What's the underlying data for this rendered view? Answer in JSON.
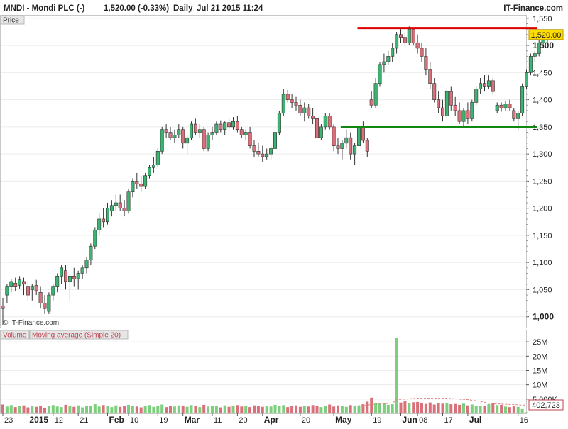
{
  "header": {
    "title": "MNDI - Mondi PLC (-)",
    "quote": "1,520.00 (-0.33%)",
    "period": "Daily",
    "datetime": "Jul 21 2015 11:24",
    "brand": "IT-Finance.com"
  },
  "price_panel": {
    "tab_label": "Price",
    "copyright": "© IT-Finance.com"
  },
  "volume_panel": {
    "tab_volume": "Volume",
    "tab_ma": "Moving average (Simple 20)"
  },
  "colors": {
    "up": "#3cb371",
    "down": "#d9707a",
    "resistance": "#dd0000",
    "support": "#118811",
    "last_price_bg": "#ffdd00",
    "volume_up": "#7ccf7c",
    "volume_down": "#d9707a",
    "ma_line": "#e08080"
  },
  "chart_data": [
    {
      "type": "candlestick",
      "title": "MNDI - Mondi PLC (-)",
      "ylim": [
        980,
        1555
      ],
      "y_ticks": [
        1000,
        1050,
        1100,
        1150,
        1200,
        1250,
        1300,
        1350,
        1400,
        1450,
        1500,
        1550
      ],
      "y_tick_labels": [
        "1,000",
        "1,050",
        "1,100",
        "1,150",
        "1,200",
        "1,250",
        "1,300",
        "1,350",
        "1,400",
        "1,450",
        "1,500",
        "1,550"
      ],
      "major_ticks": [
        1000,
        1500
      ],
      "x_labels": [
        {
          "i": 0,
          "text": "23"
        },
        {
          "i": 6,
          "text": "2015",
          "bold": true
        },
        {
          "i": 12,
          "text": "12"
        },
        {
          "i": 18,
          "text": "21"
        },
        {
          "i": 25,
          "text": "Feb",
          "bold": true
        },
        {
          "i": 30,
          "text": "10"
        },
        {
          "i": 37,
          "text": "19"
        },
        {
          "i": 43,
          "text": "Mar",
          "bold": true
        },
        {
          "i": 50,
          "text": "11"
        },
        {
          "i": 56,
          "text": "20"
        },
        {
          "i": 62,
          "text": "Apr",
          "bold": true
        },
        {
          "i": 71,
          "text": "20"
        },
        {
          "i": 79,
          "text": "May",
          "bold": true
        },
        {
          "i": 88,
          "text": "19"
        },
        {
          "i": 95,
          "text": "Jun",
          "bold": true
        },
        {
          "i": 99,
          "text": "08"
        },
        {
          "i": 105,
          "text": "17"
        },
        {
          "i": 111,
          "text": "Jul",
          "bold": true
        },
        {
          "i": 123,
          "text": "16"
        }
      ],
      "last_price": 1520.0,
      "last_price_label": "1,520.00",
      "resistance": {
        "value": 1532,
        "from": 85,
        "to": 127
      },
      "support": {
        "value": 1350,
        "from": 81,
        "to": 127
      },
      "ohlc": [
        [
          1020,
          1035,
          985,
          1015
        ],
        [
          1040,
          1060,
          1025,
          1055
        ],
        [
          1055,
          1070,
          1045,
          1065
        ],
        [
          1062,
          1072,
          1048,
          1055
        ],
        [
          1058,
          1075,
          1052,
          1068
        ],
        [
          1065,
          1072,
          1040,
          1060
        ],
        [
          1055,
          1065,
          1030,
          1040
        ],
        [
          1050,
          1060,
          1030,
          1055
        ],
        [
          1058,
          1068,
          1040,
          1048
        ],
        [
          1045,
          1055,
          1015,
          1025
        ],
        [
          1025,
          1040,
          1005,
          1015
        ],
        [
          1010,
          1045,
          1005,
          1040
        ],
        [
          1040,
          1060,
          1030,
          1055
        ],
        [
          1055,
          1080,
          1045,
          1075
        ],
        [
          1075,
          1095,
          1060,
          1090
        ],
        [
          1085,
          1095,
          1050,
          1065
        ],
        [
          1065,
          1080,
          1030,
          1075
        ],
        [
          1075,
          1090,
          1055,
          1070
        ],
        [
          1070,
          1085,
          1050,
          1080
        ],
        [
          1080,
          1095,
          1070,
          1090
        ],
        [
          1090,
          1110,
          1080,
          1105
        ],
        [
          1105,
          1135,
          1095,
          1130
        ],
        [
          1130,
          1165,
          1125,
          1160
        ],
        [
          1160,
          1190,
          1150,
          1180
        ],
        [
          1180,
          1200,
          1165,
          1175
        ],
        [
          1175,
          1210,
          1170,
          1200
        ],
        [
          1195,
          1215,
          1185,
          1205
        ],
        [
          1205,
          1225,
          1195,
          1210
        ],
        [
          1210,
          1225,
          1195,
          1200
        ],
        [
          1200,
          1215,
          1185,
          1195
        ],
        [
          1195,
          1235,
          1190,
          1230
        ],
        [
          1230,
          1255,
          1220,
          1250
        ],
        [
          1250,
          1265,
          1235,
          1245
        ],
        [
          1245,
          1260,
          1230,
          1240
        ],
        [
          1240,
          1265,
          1235,
          1260
        ],
        [
          1260,
          1280,
          1255,
          1275
        ],
        [
          1275,
          1295,
          1265,
          1280
        ],
        [
          1280,
          1310,
          1275,
          1305
        ],
        [
          1305,
          1350,
          1300,
          1345
        ],
        [
          1345,
          1355,
          1330,
          1340
        ],
        [
          1340,
          1350,
          1325,
          1330
        ],
        [
          1330,
          1345,
          1320,
          1335
        ],
        [
          1335,
          1355,
          1330,
          1345
        ],
        [
          1345,
          1350,
          1310,
          1320
        ],
        [
          1320,
          1335,
          1300,
          1330
        ],
        [
          1330,
          1360,
          1325,
          1355
        ],
        [
          1355,
          1365,
          1335,
          1340
        ],
        [
          1340,
          1355,
          1330,
          1345
        ],
        [
          1345,
          1350,
          1305,
          1310
        ],
        [
          1310,
          1340,
          1305,
          1335
        ],
        [
          1335,
          1350,
          1325,
          1340
        ],
        [
          1340,
          1360,
          1335,
          1355
        ],
        [
          1355,
          1362,
          1340,
          1345
        ],
        [
          1345,
          1360,
          1335,
          1358
        ],
        [
          1358,
          1365,
          1345,
          1350
        ],
        [
          1350,
          1368,
          1345,
          1360
        ],
        [
          1360,
          1370,
          1340,
          1345
        ],
        [
          1345,
          1350,
          1330,
          1335
        ],
        [
          1335,
          1345,
          1325,
          1340
        ],
        [
          1340,
          1350,
          1310,
          1315
        ],
        [
          1315,
          1325,
          1295,
          1305
        ],
        [
          1305,
          1320,
          1295,
          1300
        ],
        [
          1300,
          1315,
          1285,
          1295
        ],
        [
          1295,
          1310,
          1290,
          1300
        ],
        [
          1300,
          1315,
          1290,
          1310
        ],
        [
          1310,
          1345,
          1305,
          1340
        ],
        [
          1340,
          1380,
          1335,
          1375
        ],
        [
          1375,
          1420,
          1370,
          1410
        ],
        [
          1410,
          1418,
          1395,
          1400
        ],
        [
          1400,
          1410,
          1385,
          1395
        ],
        [
          1395,
          1405,
          1380,
          1390
        ],
        [
          1390,
          1400,
          1370,
          1375
        ],
        [
          1375,
          1395,
          1360,
          1385
        ],
        [
          1385,
          1392,
          1365,
          1370
        ],
        [
          1370,
          1385,
          1355,
          1365
        ],
        [
          1365,
          1375,
          1320,
          1330
        ],
        [
          1330,
          1355,
          1325,
          1350
        ],
        [
          1350,
          1375,
          1345,
          1370
        ],
        [
          1370,
          1375,
          1345,
          1350
        ],
        [
          1350,
          1355,
          1305,
          1315
        ],
        [
          1315,
          1330,
          1300,
          1310
        ],
        [
          1310,
          1325,
          1290,
          1320
        ],
        [
          1320,
          1345,
          1310,
          1330
        ],
        [
          1330,
          1340,
          1290,
          1300
        ],
        [
          1300,
          1320,
          1280,
          1315
        ],
        [
          1315,
          1355,
          1310,
          1350
        ],
        [
          1350,
          1360,
          1320,
          1325
        ],
        [
          1325,
          1330,
          1295,
          1305
        ],
        [
          1400,
          1415,
          1385,
          1390
        ],
        [
          1390,
          1440,
          1385,
          1430
        ],
        [
          1430,
          1470,
          1425,
          1465
        ],
        [
          1465,
          1485,
          1450,
          1470
        ],
        [
          1470,
          1490,
          1465,
          1480
        ],
        [
          1480,
          1505,
          1470,
          1495
        ],
        [
          1495,
          1525,
          1485,
          1520
        ],
        [
          1520,
          1530,
          1505,
          1515
        ],
        [
          1515,
          1525,
          1500,
          1505
        ],
        [
          1505,
          1535,
          1500,
          1530
        ],
        [
          1530,
          1532,
          1500,
          1505
        ],
        [
          1505,
          1520,
          1485,
          1495
        ],
        [
          1495,
          1505,
          1470,
          1480
        ],
        [
          1480,
          1495,
          1445,
          1455
        ],
        [
          1455,
          1470,
          1420,
          1430
        ],
        [
          1430,
          1440,
          1395,
          1400
        ],
        [
          1400,
          1415,
          1375,
          1385
        ],
        [
          1385,
          1400,
          1360,
          1370
        ],
        [
          1370,
          1420,
          1365,
          1415
        ],
        [
          1415,
          1425,
          1380,
          1390
        ],
        [
          1390,
          1405,
          1370,
          1380
        ],
        [
          1380,
          1395,
          1355,
          1360
        ],
        [
          1360,
          1385,
          1350,
          1380
        ],
        [
          1380,
          1395,
          1355,
          1365
        ],
        [
          1365,
          1400,
          1360,
          1395
        ],
        [
          1395,
          1425,
          1390,
          1420
        ],
        [
          1420,
          1440,
          1410,
          1430
        ],
        [
          1430,
          1445,
          1415,
          1425
        ],
        [
          1425,
          1445,
          1420,
          1435
        ],
        [
          1435,
          1440,
          1410,
          1415
        ],
        [
          1380,
          1395,
          1375,
          1390
        ],
        [
          1390,
          1395,
          1378,
          1385
        ],
        [
          1385,
          1398,
          1380,
          1392
        ],
        [
          1392,
          1400,
          1380,
          1385
        ],
        [
          1380,
          1385,
          1360,
          1365
        ],
        [
          1365,
          1380,
          1345,
          1375
        ],
        [
          1375,
          1430,
          1370,
          1425
        ],
        [
          1425,
          1455,
          1420,
          1450
        ],
        [
          1450,
          1485,
          1445,
          1480
        ],
        [
          1480,
          1490,
          1470,
          1485
        ],
        [
          1485,
          1512,
          1480,
          1505
        ],
        [
          1505,
          1520,
          1500,
          1515
        ],
        [
          1515,
          1525,
          1505,
          1520
        ]
      ]
    },
    {
      "type": "bar",
      "title": "Volume",
      "ylim": [
        0,
        29000000
      ],
      "y_ticks": [
        5000000,
        10000000,
        15000000,
        20000000,
        25000000
      ],
      "y_tick_labels": [
        "5,000K",
        "10M",
        "15M",
        "20M",
        "25M"
      ],
      "last_value_label": "402,723",
      "values": [
        3.1,
        2.4,
        2.9,
        2.2,
        2.5,
        2.8,
        2.1,
        2.6,
        2.3,
        2.7,
        2.0,
        2.5,
        2.9,
        2.4,
        2.2,
        3.0,
        2.6,
        2.3,
        2.8,
        2.1,
        2.5,
        2.7,
        3.2,
        2.4,
        2.9,
        2.6,
        2.2,
        2.8,
        2.3,
        2.5,
        3.0,
        2.7,
        2.4,
        2.1,
        2.6,
        2.9,
        2.3,
        2.5,
        3.1,
        2.2,
        2.7,
        2.4,
        2.8,
        2.6,
        2.3,
        2.9,
        2.5,
        2.2,
        3.0,
        2.4,
        2.7,
        2.6,
        2.1,
        2.8,
        2.3,
        2.5,
        2.9,
        2.4,
        2.6,
        2.2,
        2.8,
        2.5,
        2.3,
        2.7,
        2.4,
        3.0,
        2.6,
        2.9,
        2.2,
        2.5,
        2.8,
        2.3,
        2.6,
        2.4,
        2.9,
        2.7,
        2.2,
        2.5,
        3.1,
        2.4,
        2.8,
        2.6,
        2.3,
        2.9,
        2.5,
        2.7,
        3.2,
        4.1,
        5.5,
        3.5,
        3.4,
        3.6,
        3.0,
        3.2,
        26.5,
        3.8,
        4.2,
        3.5,
        3.9,
        4.0,
        3.6,
        3.3,
        3.8,
        3.1,
        3.5,
        3.4,
        3.7,
        3.2,
        3.3,
        3.0,
        3.4,
        2.8,
        3.1,
        2.6,
        2.7,
        2.5,
        3.2,
        3.6,
        2.9,
        3.0,
        2.4,
        2.2,
        2.6,
        2.3,
        1.5,
        0.4
      ],
      "moving_average": [
        2.6,
        2.6,
        2.6,
        2.6,
        2.6,
        2.6,
        2.6,
        2.6,
        2.6,
        2.6,
        2.6,
        2.6,
        2.6,
        2.6,
        2.6,
        2.6,
        2.6,
        2.6,
        2.6,
        2.6,
        2.6,
        2.6,
        2.6,
        2.6,
        2.6,
        2.6,
        2.6,
        2.6,
        2.6,
        2.6,
        2.6,
        2.6,
        2.6,
        2.6,
        2.6,
        2.6,
        2.6,
        2.6,
        2.6,
        2.6,
        2.6,
        2.6,
        2.6,
        2.6,
        2.6,
        2.6,
        2.6,
        2.6,
        2.6,
        2.6,
        2.6,
        2.6,
        2.6,
        2.6,
        2.6,
        2.6,
        2.6,
        2.6,
        2.6,
        2.6,
        2.6,
        2.6,
        2.6,
        2.6,
        2.6,
        2.6,
        2.6,
        2.6,
        2.6,
        2.6,
        2.6,
        2.6,
        2.6,
        2.6,
        2.6,
        2.6,
        2.6,
        2.6,
        2.6,
        2.6,
        2.6,
        2.6,
        2.6,
        2.6,
        2.6,
        2.7,
        2.8,
        2.9,
        3.1,
        3.2,
        3.3,
        3.4,
        3.5,
        3.6,
        4.8,
        4.9,
        5.0,
        5.1,
        5.2,
        5.3,
        5.3,
        5.3,
        5.3,
        5.3,
        5.3,
        5.3,
        5.3,
        5.2,
        5.1,
        5.0,
        4.9,
        4.8,
        4.6,
        4.4,
        4.2,
        3.9,
        3.5,
        3.4,
        3.3,
        3.3,
        3.2,
        3.1,
        3.1,
        3.0,
        2.9,
        2.9
      ],
      "units": "millions"
    }
  ]
}
